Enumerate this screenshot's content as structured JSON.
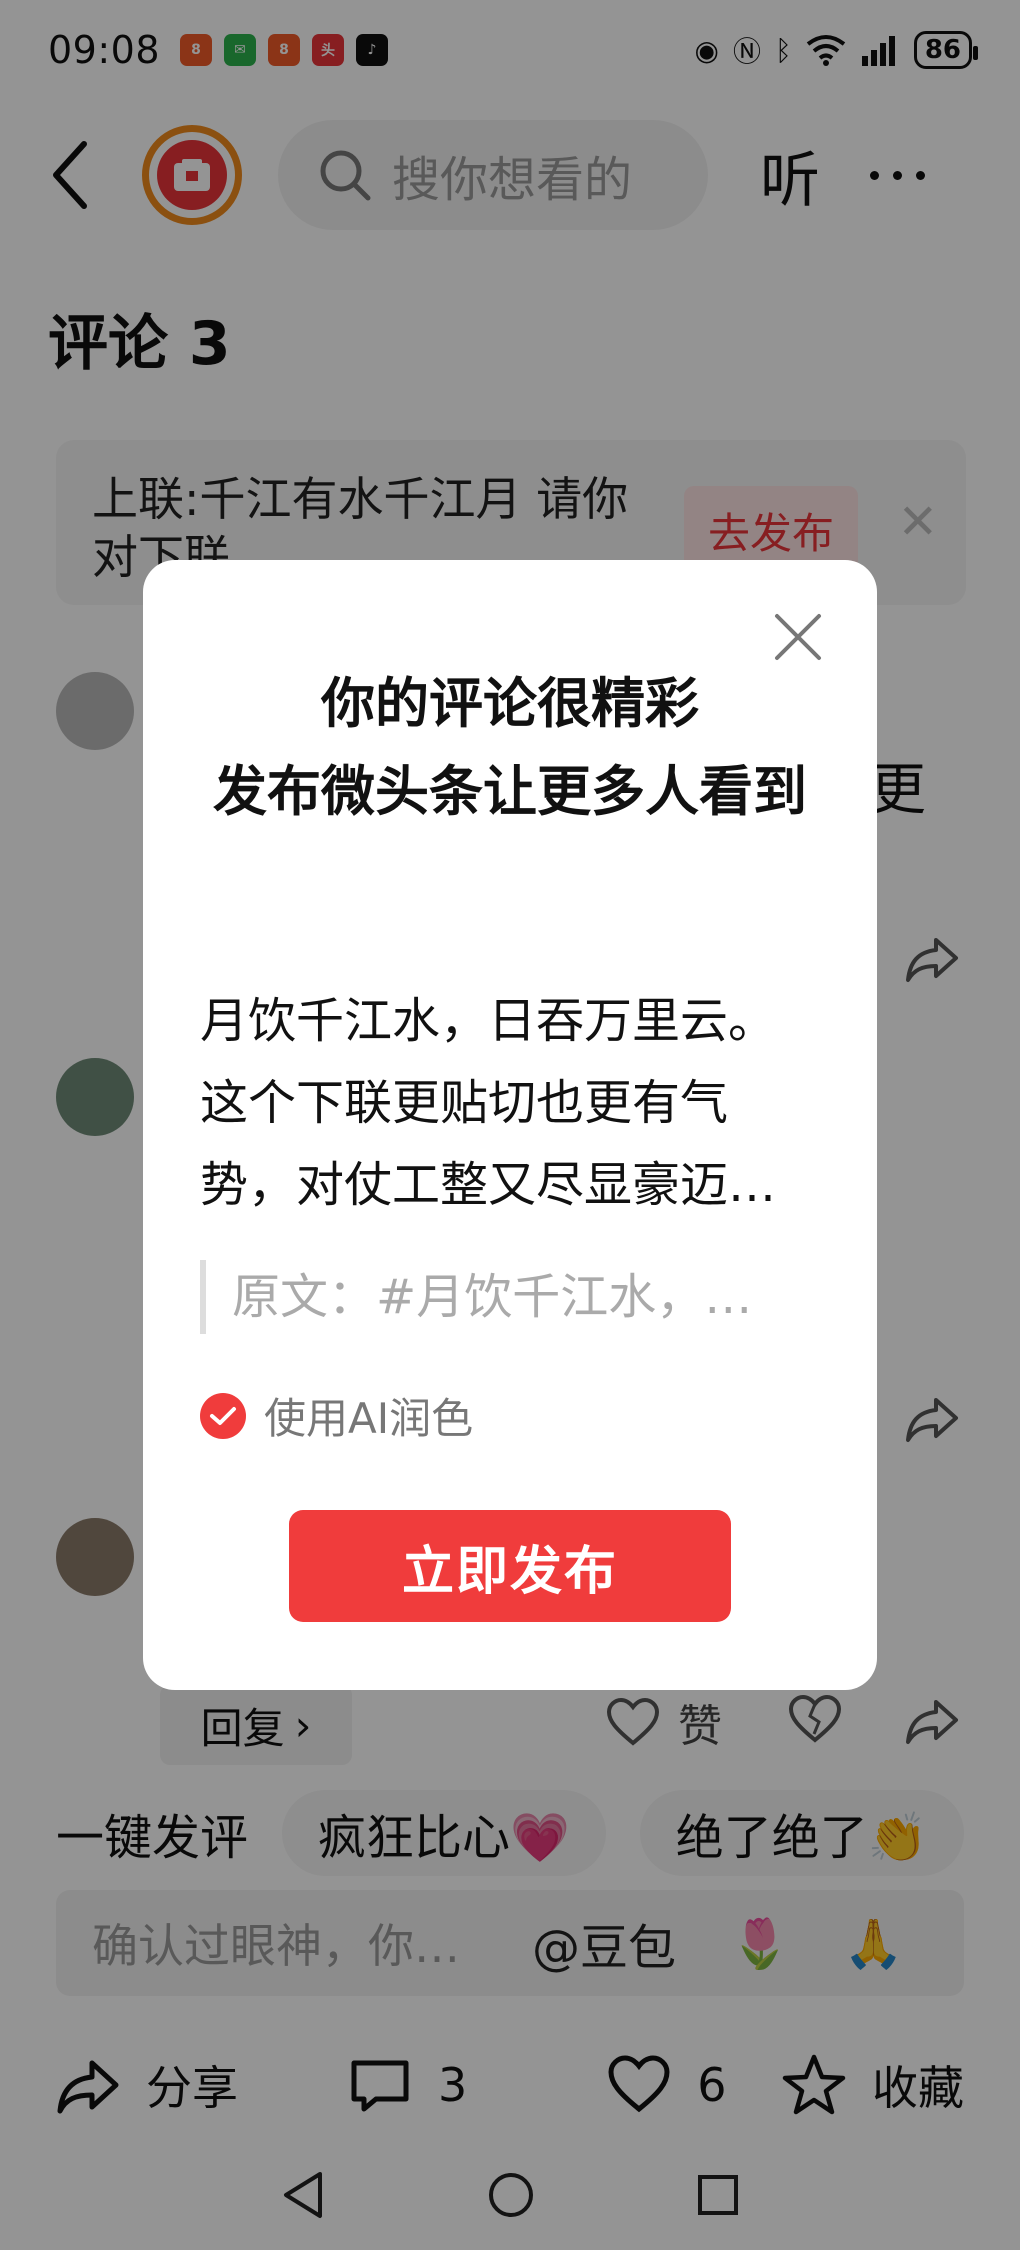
{
  "status_bar": {
    "time": "09:08",
    "battery": "86"
  },
  "header": {
    "search_placeholder": "搜你想看的",
    "listen_label": "听"
  },
  "comments": {
    "title": "评论 3",
    "couplet_text": "上联:千江有水千江月 请你对下联",
    "couplet_publish_label": "去发布",
    "partial_text": "更",
    "reply_label": "回复",
    "like_label": "赞"
  },
  "quick_reply": {
    "label": "一键发评",
    "chips": [
      "疯狂比心💗",
      "绝了绝了👏"
    ]
  },
  "input_bar": {
    "placeholder": "确认过眼神，你…",
    "mention": "@豆包",
    "emoji_1": "🌷",
    "emoji_2": "🙏"
  },
  "bottom_actions": {
    "share_label": "分享",
    "comment_count": "3",
    "like_count": "6",
    "favorite_label": "收藏"
  },
  "dialog": {
    "title_line1": "你的评论很精彩",
    "title_line2": "发布微头条让更多人看到",
    "body": "月饮千江水，日吞万里云。这个下联更贴切也更有气势，对仗工整又尽显豪迈…",
    "original": "原文：#月饮千江水，…",
    "ai_label": "使用AI润色",
    "publish_label": "立即发布"
  },
  "colors": {
    "accent": "#f03c3c",
    "brand_orange": "#f08a1c"
  }
}
